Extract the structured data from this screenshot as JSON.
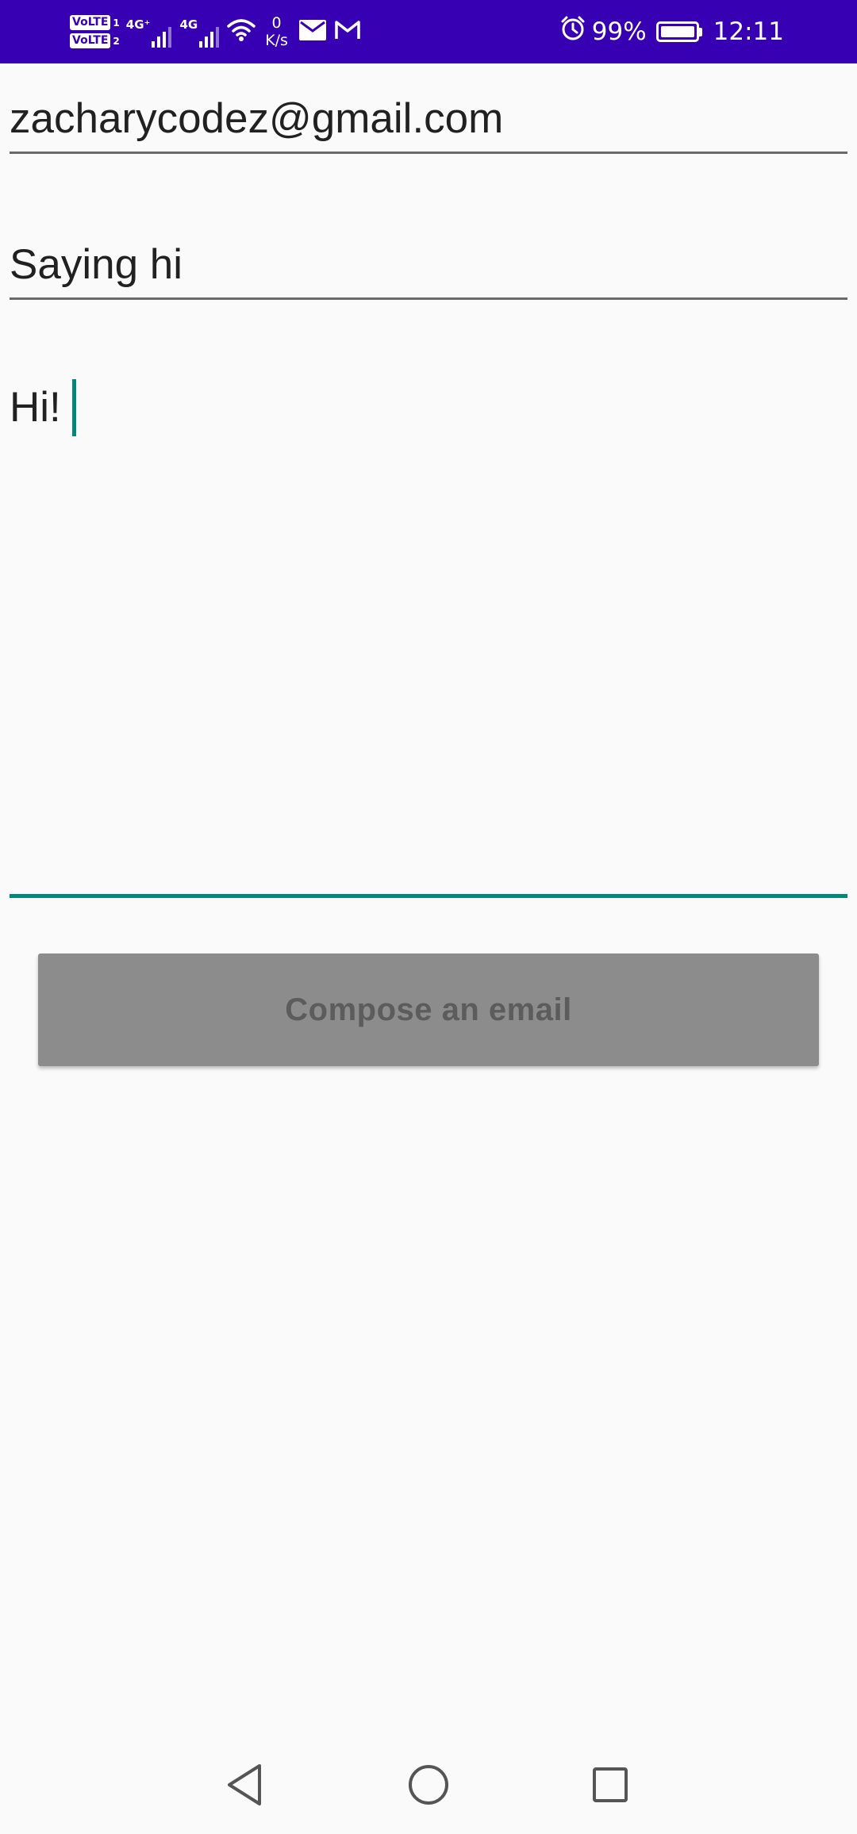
{
  "status_bar": {
    "volte_1": "VoLTE",
    "sim_1": "1",
    "volte_2": "VoLTE",
    "sim_2": "2",
    "network_1": "4G⁺",
    "network_2": "4G",
    "speed_value": "0",
    "speed_unit": "K/s",
    "battery_percent": "99%",
    "time": "12:11",
    "background_color": "#3700b3",
    "icons": [
      "signal-icon",
      "wifi-icon",
      "mail-icon",
      "gmail-icon",
      "alarm-icon",
      "battery-icon"
    ]
  },
  "form": {
    "email_value": "zacharycodez@gmail.com",
    "subject_value": "Saying hi",
    "message_value": "Hi!",
    "accent_color": "#00897b"
  },
  "compose_button": {
    "label": "Compose an email"
  },
  "nav_bar": {
    "icons": [
      "back-icon",
      "home-icon",
      "recents-icon"
    ]
  }
}
